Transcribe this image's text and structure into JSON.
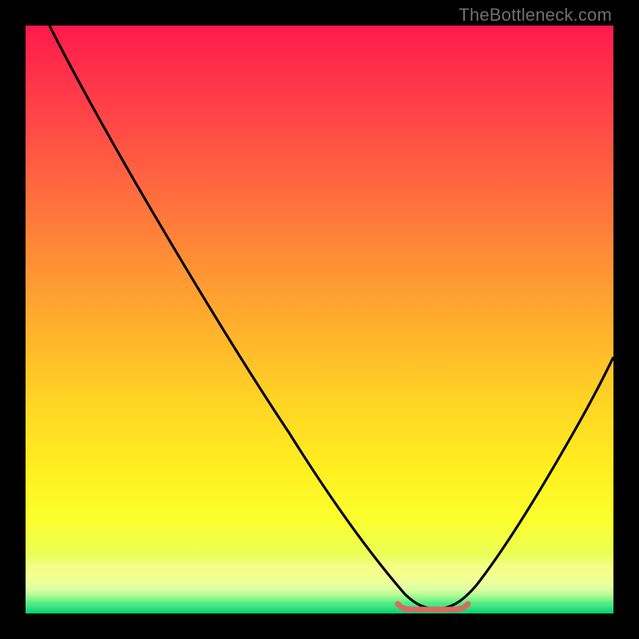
{
  "watermark": "TheBottleneck.com",
  "colors": {
    "top": "#ff1a4c",
    "mid": "#ffd424",
    "bottom_band": "#fbff2e",
    "green": "#00d46a",
    "curve": "#000000",
    "marker": "#d96a63"
  },
  "chart_data": {
    "type": "line",
    "title": "",
    "xlabel": "",
    "ylabel": "",
    "xlim": [
      0,
      100
    ],
    "ylim": [
      0,
      100
    ],
    "grid": false,
    "legend": false,
    "series": [
      {
        "name": "bottleneck-curve",
        "x": [
          4,
          10,
          18,
          26,
          34,
          42,
          50,
          56,
          62,
          66,
          70,
          74,
          78,
          82,
          88,
          94,
          100
        ],
        "y": [
          100,
          90,
          78,
          66,
          54,
          42,
          30,
          20,
          9,
          3,
          0,
          1,
          6,
          14,
          26,
          40,
          55
        ]
      }
    ],
    "valley_marker": {
      "name": "valley-highlight",
      "x_start": 63,
      "x_end": 74,
      "y": 0.5,
      "color": "#d96a63"
    }
  }
}
